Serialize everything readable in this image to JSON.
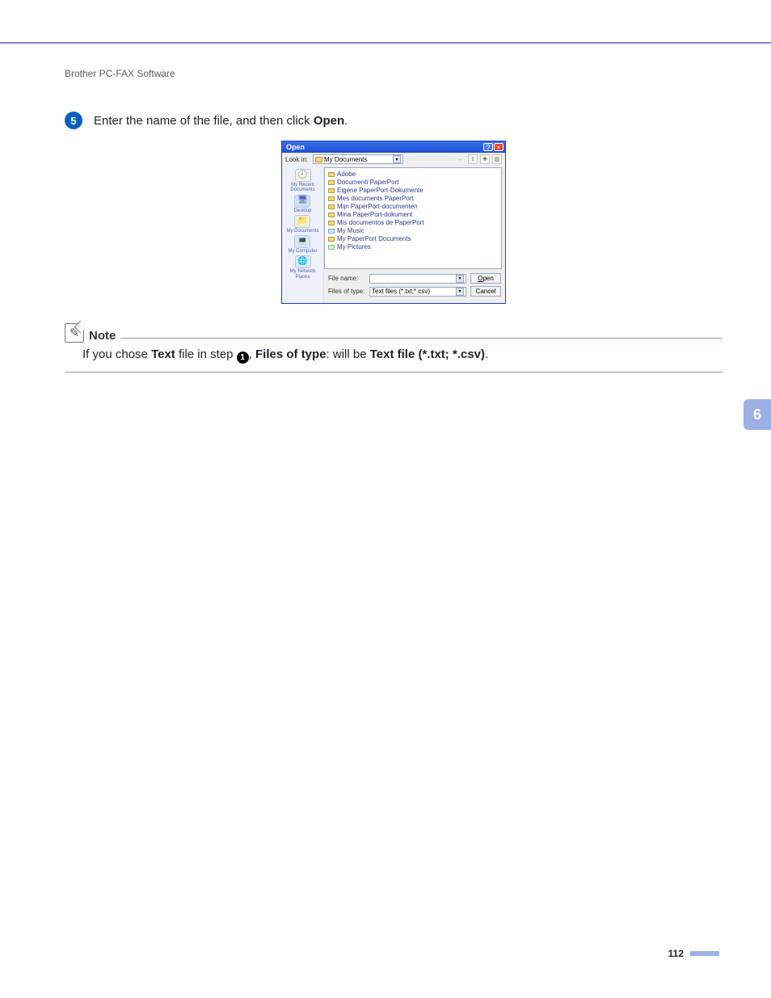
{
  "header": {
    "running_title": "Brother PC-FAX Software"
  },
  "step": {
    "number": "5",
    "text_prefix": "Enter the name of the file, and then click ",
    "bold": "Open",
    "suffix": "."
  },
  "dialog": {
    "title": "Open",
    "lookin_label": "Look in:",
    "lookin_value": "My Documents",
    "toolbar_icons": {
      "back": "←",
      "up": "⇧",
      "new": "✚",
      "views": "▥"
    },
    "places": {
      "recent": "My Recent Documents",
      "desktop": "Desktop",
      "documents": "My Documents",
      "computer": "My Computer",
      "network": "My Network Places"
    },
    "files": [
      "Adobe",
      "Documenti PaperPort",
      "Eigene PaperPort-Dokumente",
      "Mes documents PaperPort",
      "Mijn PaperPort-documenten",
      "Mina PaperPort-dokument",
      "Mis documentos de PaperPort",
      "My Music",
      "My PaperPort Documents",
      "My Pictures"
    ],
    "filename_label": "File name:",
    "filename_value": "",
    "filetype_label": "Files of type:",
    "filetype_value": "Text files (*.txt;*.csv)",
    "open_btn": "Open",
    "cancel_btn": "Cancel"
  },
  "note": {
    "heading": "Note",
    "prefix": "If you chose ",
    "bold1": "Text",
    "mid1": " file in step ",
    "ref": "1",
    "mid2": ", ",
    "bold2": "Files of type",
    "mid3": ": will be ",
    "bold3": "Text file (*.txt; *.csv)",
    "suffix": "."
  },
  "side_tab": "6",
  "page_number": "112"
}
